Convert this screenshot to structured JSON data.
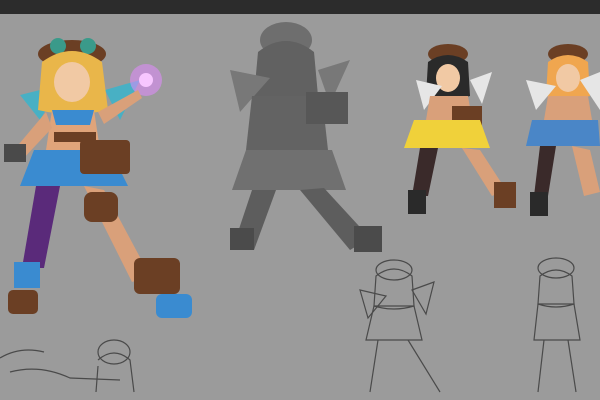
{
  "image": {
    "kind": "character concept art sheet",
    "background_color": "#9b9b9b",
    "top_bar_color": "#2c2c2c"
  },
  "figures": [
    {
      "id": "hero-full-color",
      "style": "full-color render",
      "palette": [
        "#6b3f24",
        "#3a8bd0",
        "#f3c24b",
        "#5a2a7a",
        "#d9a07a"
      ]
    },
    {
      "id": "value-sketch",
      "style": "grayscale value study",
      "palette": [
        "#5c5c5c",
        "#7a7a7a",
        "#3f3f3f"
      ]
    },
    {
      "id": "color-variant-yellow",
      "style": "flat color variant",
      "palette": [
        "#f0d13a",
        "#6b3f24",
        "#2a2a2a"
      ]
    },
    {
      "id": "color-variant-blue",
      "style": "flat color variant",
      "palette": [
        "#4a86c7",
        "#6b3f24",
        "#2a2a2a"
      ]
    },
    {
      "id": "line-sketch-center",
      "style": "line sketch"
    },
    {
      "id": "line-sketch-right",
      "style": "line sketch"
    },
    {
      "id": "line-sketch-bottom-left",
      "style": "line sketch"
    }
  ]
}
